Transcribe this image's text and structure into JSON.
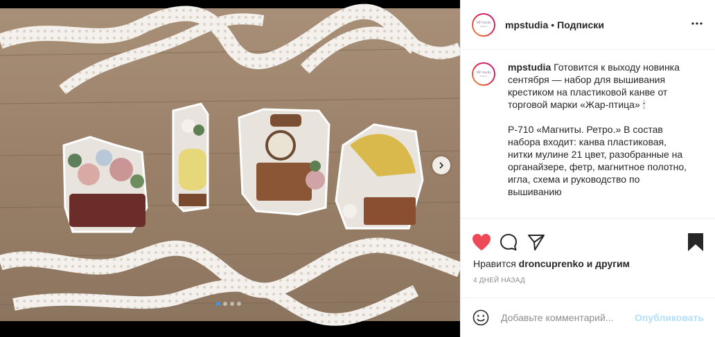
{
  "photo": {
    "alt": "Cross-stitch magnets on wooden table with lace ribbons",
    "slides_total": 4,
    "active_slide": 1
  },
  "header": {
    "username": "mpstudia",
    "separator": "•",
    "follow_label": "Подписки",
    "avatar_logo": "MP Studia",
    "avatar_sub": "Россия"
  },
  "caption": {
    "username": "mpstudia",
    "paragraph1": "Готовится к выходу новинка сентября — набор для вышивания крестиком на пластиковой канве от торговой марки «Жар-птица» 🕯",
    "paragraph2": "Р-710 «Магниты. Ретро.» В состав набора входит: канва пластиковая, нитки мулине 21 цвет, разобранные на органайзере, фетр, магнитное полотно, игла, схема и руководство по вышиванию"
  },
  "actions": {
    "liked": true,
    "icons": [
      "heart-icon",
      "comment-icon",
      "share-icon",
      "bookmark-icon"
    ],
    "colors": {
      "heart": "#ed4956",
      "post_disabled": "#b2dffc"
    }
  },
  "likes": {
    "prefix": "Нравится",
    "user": "droncuprenko",
    "suffix": "и другим"
  },
  "date": "4 ДНЕЙ НАЗАД",
  "comment": {
    "placeholder": "Добавьте комментарий...",
    "post_label": "Опубликовать"
  }
}
